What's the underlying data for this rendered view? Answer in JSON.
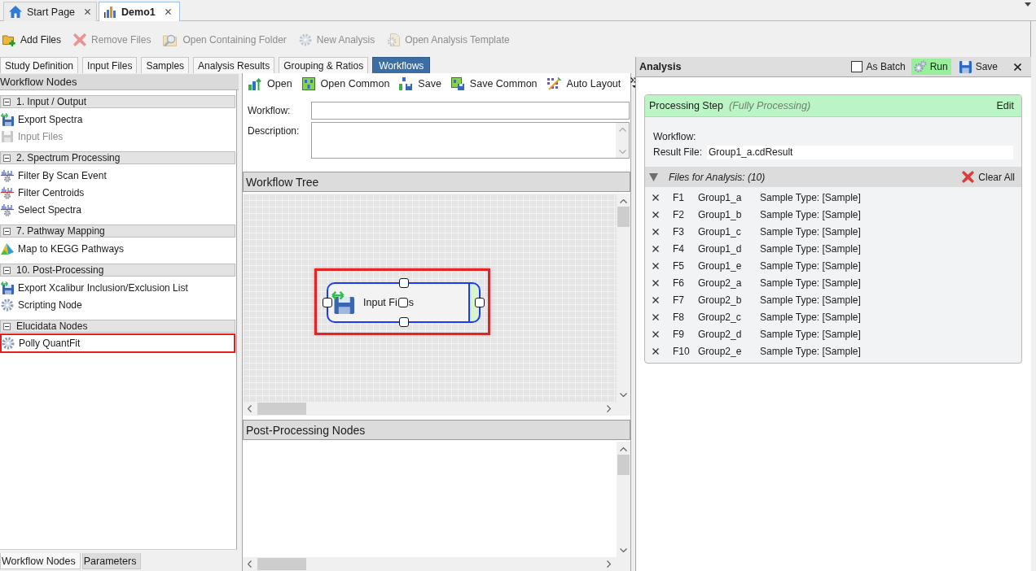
{
  "document_tabs": [
    {
      "label": "Start Page",
      "kind": "home",
      "selected": false
    },
    {
      "label": "Demo1",
      "kind": "chart",
      "selected": true
    }
  ],
  "toolbar": [
    {
      "label": "Add Files",
      "kind": "add_files",
      "disabled": false
    },
    {
      "label": "Remove Files",
      "kind": "remove",
      "disabled": true
    },
    {
      "label": "Open Containing Folder",
      "kind": "folder_search",
      "disabled": true
    },
    {
      "label": "New Analysis",
      "kind": "gear",
      "disabled": true
    },
    {
      "label": "Open Analysis Template",
      "kind": "template",
      "disabled": true
    }
  ],
  "study_tabs": [
    {
      "label": "Study Definition",
      "selected": false
    },
    {
      "label": "Input Files",
      "selected": false
    },
    {
      "label": "Samples",
      "selected": false
    },
    {
      "label": "Analysis Results",
      "selected": false
    },
    {
      "label": "Grouping & Ratios",
      "selected": false
    },
    {
      "label": "Workflows",
      "selected": true
    }
  ],
  "workflow_nodes": {
    "title": "Workflow Nodes",
    "groups": [
      {
        "title": "1. Input / Output",
        "expanded": true,
        "items": [
          {
            "label": "Export Spectra",
            "kind": "export",
            "disabled": false,
            "highlighted": false
          },
          {
            "label": "Input Files",
            "kind": "input",
            "disabled": true,
            "highlighted": false
          }
        ]
      },
      {
        "title": "2. Spectrum Processing",
        "expanded": true,
        "items": [
          {
            "label": "Filter By Scan Event",
            "kind": "filter",
            "disabled": false,
            "highlighted": false
          },
          {
            "label": "Filter Centroids",
            "kind": "filter",
            "disabled": false,
            "highlighted": false
          },
          {
            "label": "Select Spectra",
            "kind": "filter",
            "disabled": false,
            "highlighted": false
          }
        ]
      },
      {
        "title": "7. Pathway Mapping",
        "expanded": true,
        "items": [
          {
            "label": "Map to KEGG Pathways",
            "kind": "map",
            "disabled": false,
            "highlighted": false
          }
        ]
      },
      {
        "title": "10. Post-Processing",
        "expanded": true,
        "items": [
          {
            "label": "Export Xcalibur Inclusion/Exclusion List",
            "kind": "export",
            "disabled": false,
            "highlighted": false
          },
          {
            "label": "Scripting Node",
            "kind": "gear",
            "disabled": false,
            "highlighted": false
          }
        ]
      },
      {
        "title": "Elucidata Nodes",
        "expanded": true,
        "items": [
          {
            "label": "Polly QuantFit",
            "kind": "gear",
            "disabled": false,
            "highlighted": true
          }
        ]
      }
    ],
    "bottom_tabs": [
      {
        "label": "Workflow Nodes",
        "selected": true
      },
      {
        "label": "Parameters",
        "selected": false
      }
    ]
  },
  "workflow_editor": {
    "toolbar": [
      {
        "label": "Open",
        "kind": "open"
      },
      {
        "label": "Open Common",
        "kind": "open_common"
      },
      {
        "label": "Save",
        "kind": "save"
      },
      {
        "label": "Save Common",
        "kind": "save_common"
      },
      {
        "label": "Auto Layout",
        "kind": "auto_layout"
      }
    ],
    "workflow_label": "Workflow:",
    "description_label": "Description:",
    "tree_title": "Workflow Tree",
    "tree_nodes": [
      {
        "label_parts": [
          "Input Fi",
          "s"
        ],
        "selected": true,
        "highlighted": true
      }
    ],
    "post_processing_title": "Post-Processing Nodes"
  },
  "analysis": {
    "title": "Analysis",
    "as_batch": {
      "label": "As Batch",
      "checked": false
    },
    "run": {
      "label": "Run",
      "highlighted": true
    },
    "save": {
      "label": "Save"
    },
    "processing_step": {
      "title": "Processing Step",
      "mode": "(Fully Processing)",
      "edit": "Edit",
      "workflow_label": "Workflow:",
      "result_file_label": "Result File:",
      "result_file": "Group1_a.cdResult"
    },
    "files": {
      "title": "Files for Analysis: (10)",
      "expanded": true,
      "clear_all": "Clear All",
      "rows": [
        {
          "id": "F1",
          "name": "Group1_a",
          "sample_type": "Sample Type: [Sample]"
        },
        {
          "id": "F2",
          "name": "Group1_b",
          "sample_type": "Sample Type: [Sample]"
        },
        {
          "id": "F3",
          "name": "Group1_c",
          "sample_type": "Sample Type: [Sample]"
        },
        {
          "id": "F4",
          "name": "Group1_d",
          "sample_type": "Sample Type: [Sample]"
        },
        {
          "id": "F5",
          "name": "Group1_e",
          "sample_type": "Sample Type: [Sample]"
        },
        {
          "id": "F6",
          "name": "Group2_a",
          "sample_type": "Sample Type: [Sample]"
        },
        {
          "id": "F7",
          "name": "Group2_b",
          "sample_type": "Sample Type: [Sample]"
        },
        {
          "id": "F8",
          "name": "Group2_c",
          "sample_type": "Sample Type: [Sample]"
        },
        {
          "id": "F9",
          "name": "Group2_d",
          "sample_type": "Sample Type: [Sample]"
        },
        {
          "id": "F10",
          "name": "Group2_e",
          "sample_type": "Sample Type: [Sample]"
        }
      ]
    }
  }
}
